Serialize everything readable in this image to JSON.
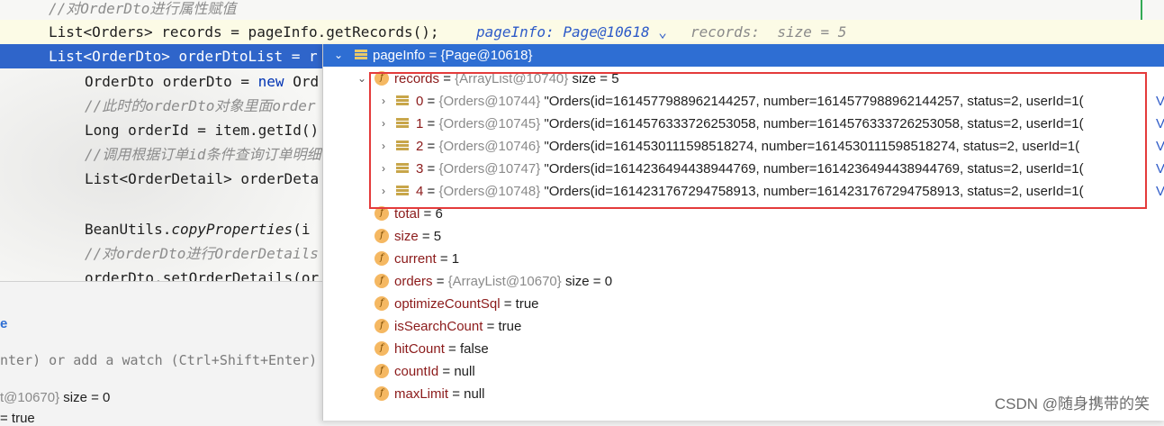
{
  "editor": {
    "lines": [
      {
        "text": "//对OrderDto进行属性赋值",
        "type": "comment"
      },
      {
        "text": "List<Orders> records = pageInfo.getRecords();",
        "type": "code"
      },
      {
        "text": "List<OrderDto> orderDtoList = r",
        "type": "code"
      },
      {
        "pre": "OrderDto orderDto = ",
        "kw": "new",
        "post": " Ord"
      },
      {
        "text": "//此时的orderDto对象里面order",
        "type": "comment"
      },
      {
        "text": "Long orderId = item.getId()",
        "type": "code"
      },
      {
        "text": "//调用根据订单id条件查询订单明细",
        "type": "comment"
      },
      {
        "text": "List<OrderDetail> orderDeta",
        "type": "code"
      },
      {
        "pre": "BeanUtils.",
        "it": "copyProperties",
        "post": "(i"
      },
      {
        "text": "//对orderDto进行OrderDetails",
        "type": "comment"
      },
      {
        "text": "orderDto.setOrderDetails(or",
        "type": "code"
      }
    ],
    "inline_hint_page": "pageInfo: Page@10618",
    "inline_hint_chevron": "⌄",
    "inline_hint_records": "records:  size = 5"
  },
  "debug_panel": {
    "e_label": "e",
    "watch_hint": "nter) or add a watch (Ctrl+Shift+Enter)",
    "row1_ref": "t@10670}",
    "row1_val": " size = 0",
    "row2_val": "= true"
  },
  "popup": {
    "header": "pageInfo = {Page@10618}",
    "records": {
      "name": "records",
      "ref": "{ArrayList@10740}",
      "size": "size = 5"
    },
    "items": [
      {
        "idx": "0",
        "ref": "{Orders@10744}",
        "val": "\"Orders(id=1614577988962144257, number=1614577988962144257, status=2, userId=1("
      },
      {
        "idx": "1",
        "ref": "{Orders@10745}",
        "val": "\"Orders(id=1614576333726253058, number=1614576333726253058, status=2, userId=1("
      },
      {
        "idx": "2",
        "ref": "{Orders@10746}",
        "val": "\"Orders(id=1614530111598518274, number=1614530111598518274, status=2, userId=1("
      },
      {
        "idx": "3",
        "ref": "{Orders@10747}",
        "val": "\"Orders(id=1614236494438944769, number=1614236494438944769, status=2, userId=1("
      },
      {
        "idx": "4",
        "ref": "{Orders@10748}",
        "val": "\"Orders(id=1614231767294758913, number=1614231767294758913, status=2, userId=1("
      }
    ],
    "view_link": "V",
    "fields": [
      {
        "name": "total",
        "val": "= 6"
      },
      {
        "name": "size",
        "val": "= 5"
      },
      {
        "name": "current",
        "val": "= 1"
      },
      {
        "name": "orders",
        "ref": "{ArrayList@10670}",
        "val": "size = 0"
      },
      {
        "name": "optimizeCountSql",
        "val": "= true"
      },
      {
        "name": "isSearchCount",
        "val": "= true"
      },
      {
        "name": "hitCount",
        "val": "= false"
      },
      {
        "name": "countId",
        "val": "= null"
      },
      {
        "name": "maxLimit",
        "val": "= null"
      }
    ],
    "field_icon_letter": "f",
    "eq": " = "
  },
  "watermark": "CSDN @随身携带的笑",
  "colors": {
    "selection": "#2f65ca",
    "header": "#2e6ed3",
    "highlight_box": "#e43b3b"
  }
}
